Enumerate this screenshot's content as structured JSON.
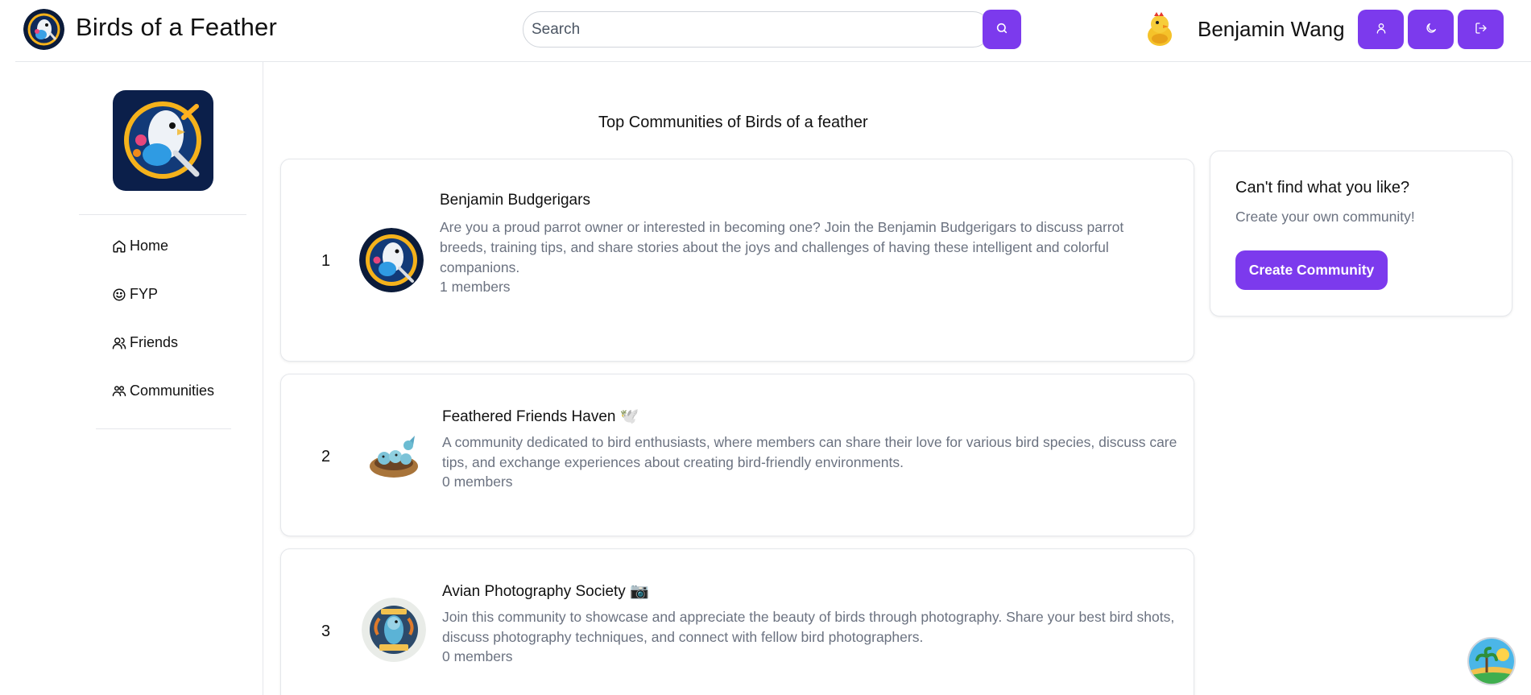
{
  "header": {
    "app_title": "Birds of a Feather",
    "search_placeholder": "Search",
    "user_name": "Benjamin Wang",
    "buttons": [
      "profile",
      "theme",
      "logout"
    ]
  },
  "sidebar": {
    "items": [
      {
        "label": "Home",
        "icon": "home-icon"
      },
      {
        "label": "FYP",
        "icon": "smile-icon"
      },
      {
        "label": "Friends",
        "icon": "users-icon"
      },
      {
        "label": "Communities",
        "icon": "users-group-icon"
      }
    ]
  },
  "main": {
    "title": "Top Communities of Birds of a feather",
    "communities": [
      {
        "rank": "1",
        "name": "Benjamin Budgerigars",
        "emoji": "",
        "description": "Are you a proud parrot owner or interested in becoming one? Join the Benjamin Budgerigars to discuss parrot breeds, training tips, and share stories about the joys and challenges of having these intelligent and colorful companions.",
        "members": "1 members"
      },
      {
        "rank": "2",
        "name": "Feathered Friends Haven",
        "emoji": "🕊️",
        "description": "A community dedicated to bird enthusiasts, where members can share their love for various bird species, discuss care tips, and exchange experiences about creating bird-friendly environments.",
        "members": "0 members"
      },
      {
        "rank": "3",
        "name": "Avian Photography Society",
        "emoji": "📷",
        "description": "Join this community to showcase and appreciate the beauty of birds through photography. Share your best bird shots, discuss photography techniques, and connect with fellow bird photographers.",
        "members": "0 members"
      }
    ]
  },
  "panel": {
    "title": "Can't find what you like?",
    "subtitle": "Create your own community!",
    "button_label": "Create Community"
  },
  "colors": {
    "accent": "#7c3aed",
    "muted_text": "#6b7280",
    "border": "#e5e7eb"
  }
}
